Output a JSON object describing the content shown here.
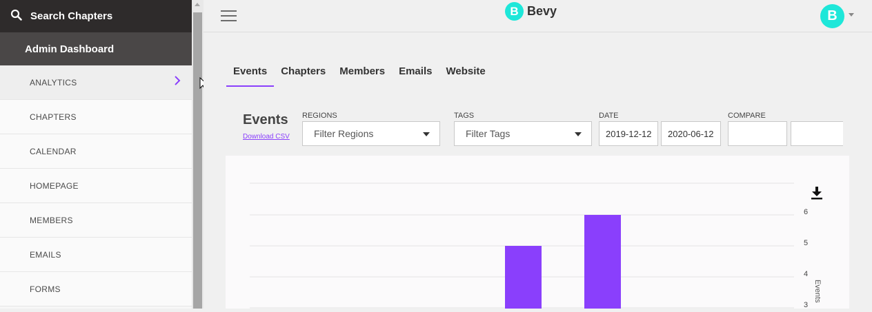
{
  "sidebar": {
    "search_label": "Search Chapters",
    "admin_label": "Admin Dashboard",
    "items": [
      {
        "label": "ANALYTICS"
      },
      {
        "label": "CHAPTERS"
      },
      {
        "label": "CALENDAR"
      },
      {
        "label": "HOMEPAGE"
      },
      {
        "label": "MEMBERS"
      },
      {
        "label": "EMAILS"
      },
      {
        "label": "FORMS"
      }
    ]
  },
  "header": {
    "logo_text": "Bevy",
    "logo_mark": "B",
    "avatar_initial": "B"
  },
  "tabs": [
    {
      "label": "Events"
    },
    {
      "label": "Chapters"
    },
    {
      "label": "Members"
    },
    {
      "label": "Emails"
    },
    {
      "label": "Website"
    }
  ],
  "filters": {
    "title": "Events",
    "download_label": "Download CSV",
    "regions_label": "REGIONS",
    "regions_value": "Filter Regions",
    "tags_label": "TAGS",
    "tags_value": "Filter Tags",
    "date_label": "DATE",
    "date_start": "2019-12-12",
    "date_end": "2020-06-12",
    "compare_label": "COMPARE",
    "compare_start": "",
    "compare_end": ""
  },
  "colors": {
    "accent": "#8a3ffc",
    "brand": "#1ee7d9",
    "sidebar_dark": "#2e2b2b"
  },
  "chart_data": {
    "type": "bar",
    "ylabel": "Events",
    "yticks": [
      3,
      4,
      5,
      6
    ],
    "ylim": [
      2.1,
      7
    ],
    "values": [
      5,
      6
    ],
    "grid": true,
    "color": "#8a3ffc"
  }
}
